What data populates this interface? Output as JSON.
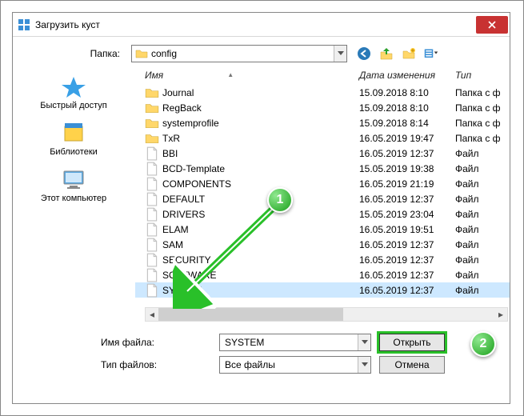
{
  "window": {
    "title": "Загрузить куст"
  },
  "toolbar": {
    "folder_label": "Папка:",
    "folder_value": "config",
    "icons": {
      "back": "back-icon",
      "up": "up-folder-icon",
      "new": "new-folder-icon",
      "view": "view-menu-icon"
    }
  },
  "sidebar": {
    "items": [
      {
        "label": "Быстрый доступ",
        "icon": "star-icon"
      },
      {
        "label": "Библиотеки",
        "icon": "libraries-icon"
      },
      {
        "label": "Этот компьютер",
        "icon": "computer-icon"
      }
    ]
  },
  "columns": {
    "name": "Имя",
    "date": "Дата изменения",
    "type": "Тип"
  },
  "files": [
    {
      "name": "Journal",
      "date": "15.09.2018 8:10",
      "type": "Папка с ф",
      "kind": "folder"
    },
    {
      "name": "RegBack",
      "date": "15.09.2018 8:10",
      "type": "Папка с ф",
      "kind": "folder"
    },
    {
      "name": "systemprofile",
      "date": "15.09.2018 8:14",
      "type": "Папка с ф",
      "kind": "folder"
    },
    {
      "name": "TxR",
      "date": "16.05.2019 19:47",
      "type": "Папка с ф",
      "kind": "folder"
    },
    {
      "name": "BBI",
      "date": "16.05.2019 12:37",
      "type": "Файл",
      "kind": "file"
    },
    {
      "name": "BCD-Template",
      "date": "15.05.2019 19:38",
      "type": "Файл",
      "kind": "file"
    },
    {
      "name": "COMPONENTS",
      "date": "16.05.2019 21:19",
      "type": "Файл",
      "kind": "file"
    },
    {
      "name": "DEFAULT",
      "date": "16.05.2019 12:37",
      "type": "Файл",
      "kind": "file"
    },
    {
      "name": "DRIVERS",
      "date": "15.05.2019 23:04",
      "type": "Файл",
      "kind": "file"
    },
    {
      "name": "ELAM",
      "date": "16.05.2019 19:51",
      "type": "Файл",
      "kind": "file"
    },
    {
      "name": "SAM",
      "date": "16.05.2019 12:37",
      "type": "Файл",
      "kind": "file"
    },
    {
      "name": "SECURITY",
      "date": "16.05.2019 12:37",
      "type": "Файл",
      "kind": "file"
    },
    {
      "name": "SOFTWARE",
      "date": "16.05.2019 12:37",
      "type": "Файл",
      "kind": "file"
    },
    {
      "name": "SYSTEM",
      "date": "16.05.2019 12:37",
      "type": "Файл",
      "kind": "file",
      "selected": true
    }
  ],
  "bottom": {
    "filename_label": "Имя файла:",
    "filename_value": "SYSTEM",
    "filetype_label": "Тип файлов:",
    "filetype_value": "Все файлы",
    "open": "Открыть",
    "cancel": "Отмена"
  },
  "annotations": {
    "badge1": "1",
    "badge2": "2"
  }
}
